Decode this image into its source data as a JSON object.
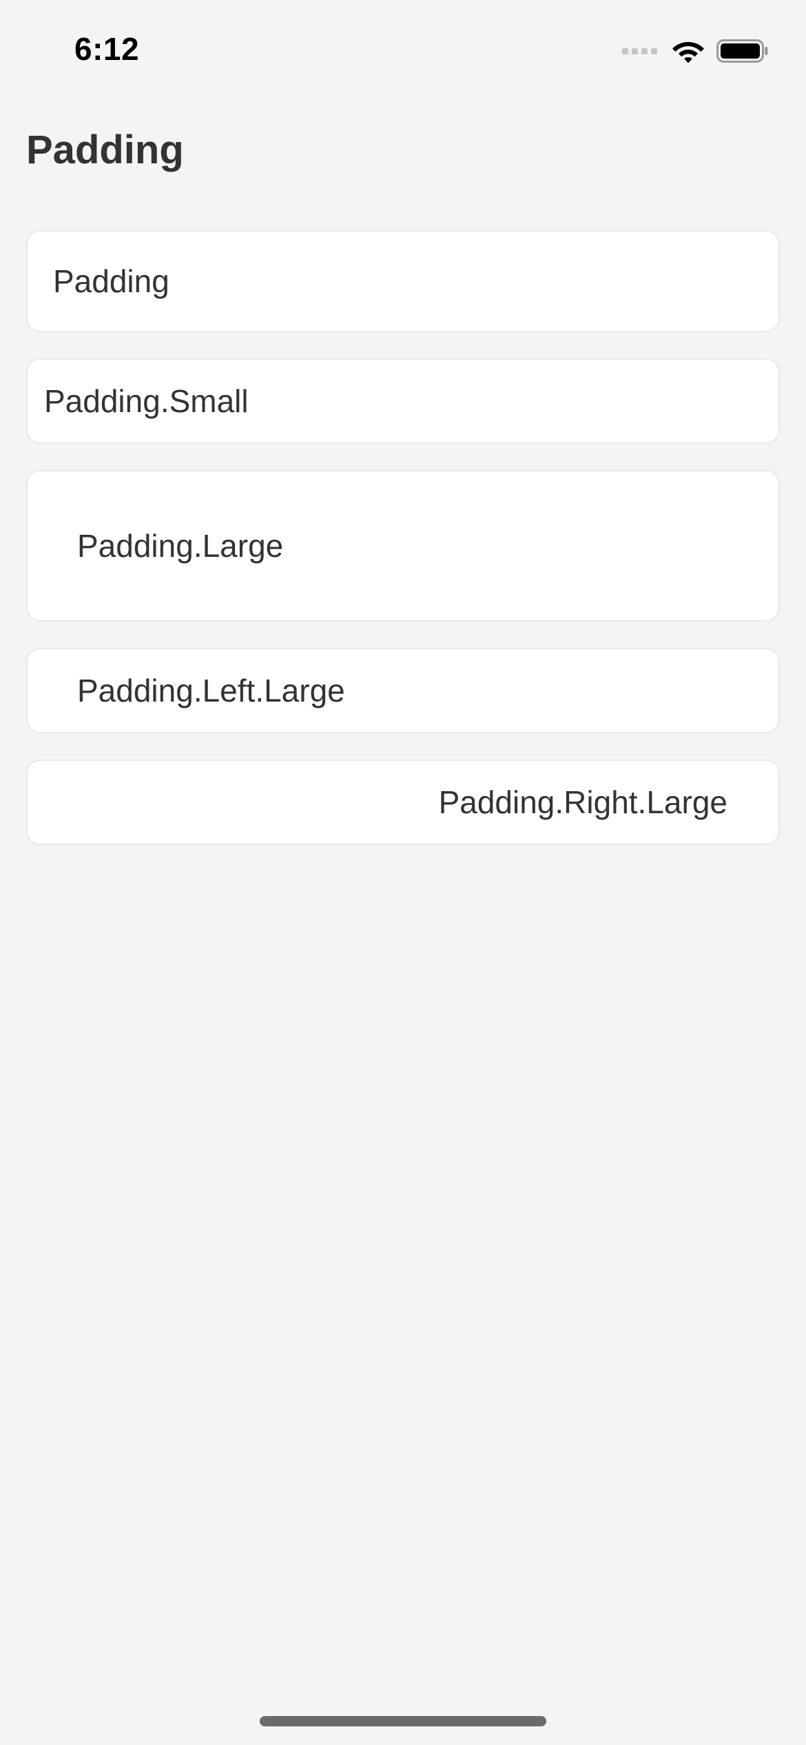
{
  "status_bar": {
    "time": "6:12",
    "icons": [
      "cellular-signal-icon",
      "wifi-icon",
      "battery-icon"
    ]
  },
  "page": {
    "title": "Padding"
  },
  "cards": [
    {
      "label": "Padding"
    },
    {
      "label": "Padding.Small"
    },
    {
      "label": "Padding.Large"
    },
    {
      "label": "Padding.Left.Large"
    },
    {
      "label": "Padding.Right.Large"
    }
  ],
  "colors": {
    "background": "#f4f4f4",
    "card": "#ffffff",
    "card_border": "#e9e9e9",
    "text": "#333333"
  }
}
